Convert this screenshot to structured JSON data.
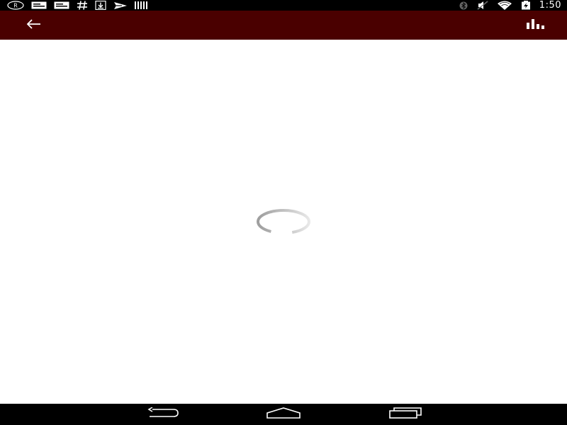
{
  "status_bar": {
    "time": "1:50",
    "left_icons": [
      "registered-icon",
      "message-icon",
      "message-icon",
      "hashtag-icon",
      "download-icon",
      "send-icon",
      "barcode-icon"
    ],
    "right_icons": [
      "bluetooth-icon",
      "mute-icon",
      "wifi-icon",
      "battery-charging-icon"
    ]
  },
  "app_bar": {
    "background_color": "#4a0000",
    "back_icon": "arrow-left-icon",
    "action_icon": "bar-chart-icon"
  },
  "content": {
    "loading": true,
    "spinner_icon": "loading-spinner-icon"
  },
  "nav_bar": {
    "buttons": [
      "back-icon",
      "home-icon",
      "recents-icon"
    ]
  }
}
